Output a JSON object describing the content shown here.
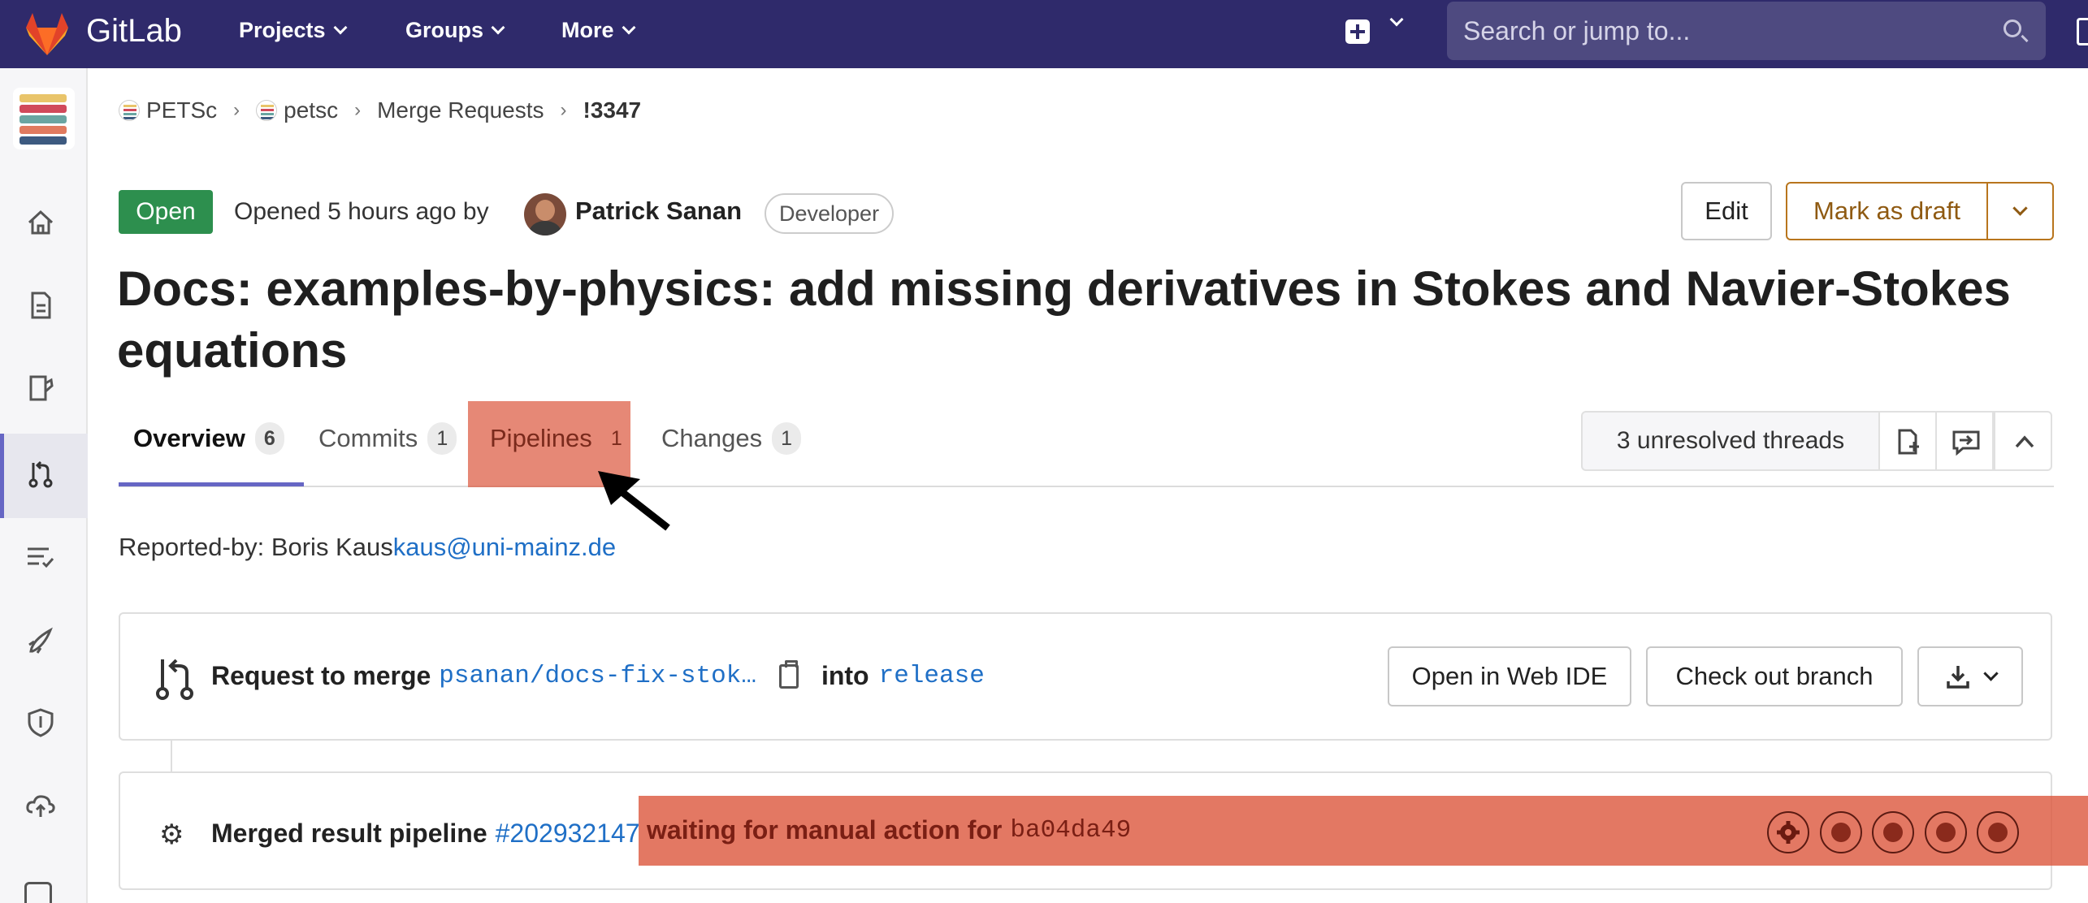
{
  "topnav": {
    "brand": "GitLab",
    "projects": "Projects",
    "groups": "Groups",
    "more": "More",
    "search_placeholder": "Search or jump to..."
  },
  "breadcrumb": {
    "items": [
      "PETSc",
      "petsc",
      "Merge Requests",
      "!3347"
    ]
  },
  "header": {
    "status": "Open",
    "opened_text": "Opened 5 hours ago by",
    "author": "Patrick Sanan",
    "role": "Developer",
    "edit_label": "Edit",
    "draft_label": "Mark as draft",
    "title": "Docs: examples-by-physics: add missing derivatives in Stokes and Navier-Stokes equations"
  },
  "tabs": [
    {
      "label": "Overview",
      "count": "6"
    },
    {
      "label": "Commits",
      "count": "1"
    },
    {
      "label": "Pipelines",
      "count": "1"
    },
    {
      "label": "Changes",
      "count": "1"
    }
  ],
  "threads": {
    "label": "3 unresolved threads"
  },
  "description": {
    "reported_prefix": "Reported-by: Boris Kaus",
    "email": "kaus@uni-mainz.de"
  },
  "merge": {
    "request_label": "Request to merge",
    "source_branch": "psanan/docs-fix-stok…",
    "into_label": "into",
    "target_branch": "release",
    "web_ide_label": "Open in Web IDE",
    "checkout_label": "Check out branch"
  },
  "pipeline": {
    "label": "Merged result pipeline",
    "id": "#202932147",
    "status": "waiting for manual action for",
    "commit": "ba04da49"
  },
  "colors": {
    "nav_bg": "#2f2a6b",
    "open_badge": "#2d8f4e",
    "link": "#1f6fc6",
    "highlight": "#dd5a41",
    "active_tab": "#6666c4"
  }
}
